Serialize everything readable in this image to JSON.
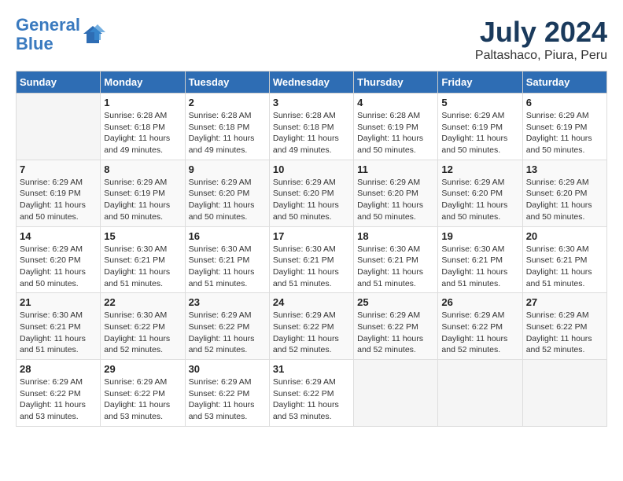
{
  "header": {
    "logo_line1": "General",
    "logo_line2": "Blue",
    "title": "July 2024",
    "subtitle": "Paltashaco, Piura, Peru"
  },
  "calendar": {
    "days_of_week": [
      "Sunday",
      "Monday",
      "Tuesday",
      "Wednesday",
      "Thursday",
      "Friday",
      "Saturday"
    ],
    "weeks": [
      [
        {
          "day": "",
          "info": ""
        },
        {
          "day": "1",
          "info": "Sunrise: 6:28 AM\nSunset: 6:18 PM\nDaylight: 11 hours and 49 minutes."
        },
        {
          "day": "2",
          "info": "Sunrise: 6:28 AM\nSunset: 6:18 PM\nDaylight: 11 hours and 49 minutes."
        },
        {
          "day": "3",
          "info": "Sunrise: 6:28 AM\nSunset: 6:18 PM\nDaylight: 11 hours and 49 minutes."
        },
        {
          "day": "4",
          "info": "Sunrise: 6:28 AM\nSunset: 6:19 PM\nDaylight: 11 hours and 50 minutes."
        },
        {
          "day": "5",
          "info": "Sunrise: 6:29 AM\nSunset: 6:19 PM\nDaylight: 11 hours and 50 minutes."
        },
        {
          "day": "6",
          "info": "Sunrise: 6:29 AM\nSunset: 6:19 PM\nDaylight: 11 hours and 50 minutes."
        }
      ],
      [
        {
          "day": "7",
          "info": "Sunrise: 6:29 AM\nSunset: 6:19 PM\nDaylight: 11 hours and 50 minutes."
        },
        {
          "day": "8",
          "info": "Sunrise: 6:29 AM\nSunset: 6:19 PM\nDaylight: 11 hours and 50 minutes."
        },
        {
          "day": "9",
          "info": "Sunrise: 6:29 AM\nSunset: 6:20 PM\nDaylight: 11 hours and 50 minutes."
        },
        {
          "day": "10",
          "info": "Sunrise: 6:29 AM\nSunset: 6:20 PM\nDaylight: 11 hours and 50 minutes."
        },
        {
          "day": "11",
          "info": "Sunrise: 6:29 AM\nSunset: 6:20 PM\nDaylight: 11 hours and 50 minutes."
        },
        {
          "day": "12",
          "info": "Sunrise: 6:29 AM\nSunset: 6:20 PM\nDaylight: 11 hours and 50 minutes."
        },
        {
          "day": "13",
          "info": "Sunrise: 6:29 AM\nSunset: 6:20 PM\nDaylight: 11 hours and 50 minutes."
        }
      ],
      [
        {
          "day": "14",
          "info": "Sunrise: 6:29 AM\nSunset: 6:20 PM\nDaylight: 11 hours and 50 minutes."
        },
        {
          "day": "15",
          "info": "Sunrise: 6:30 AM\nSunset: 6:21 PM\nDaylight: 11 hours and 51 minutes."
        },
        {
          "day": "16",
          "info": "Sunrise: 6:30 AM\nSunset: 6:21 PM\nDaylight: 11 hours and 51 minutes."
        },
        {
          "day": "17",
          "info": "Sunrise: 6:30 AM\nSunset: 6:21 PM\nDaylight: 11 hours and 51 minutes."
        },
        {
          "day": "18",
          "info": "Sunrise: 6:30 AM\nSunset: 6:21 PM\nDaylight: 11 hours and 51 minutes."
        },
        {
          "day": "19",
          "info": "Sunrise: 6:30 AM\nSunset: 6:21 PM\nDaylight: 11 hours and 51 minutes."
        },
        {
          "day": "20",
          "info": "Sunrise: 6:30 AM\nSunset: 6:21 PM\nDaylight: 11 hours and 51 minutes."
        }
      ],
      [
        {
          "day": "21",
          "info": "Sunrise: 6:30 AM\nSunset: 6:21 PM\nDaylight: 11 hours and 51 minutes."
        },
        {
          "day": "22",
          "info": "Sunrise: 6:30 AM\nSunset: 6:22 PM\nDaylight: 11 hours and 52 minutes."
        },
        {
          "day": "23",
          "info": "Sunrise: 6:29 AM\nSunset: 6:22 PM\nDaylight: 11 hours and 52 minutes."
        },
        {
          "day": "24",
          "info": "Sunrise: 6:29 AM\nSunset: 6:22 PM\nDaylight: 11 hours and 52 minutes."
        },
        {
          "day": "25",
          "info": "Sunrise: 6:29 AM\nSunset: 6:22 PM\nDaylight: 11 hours and 52 minutes."
        },
        {
          "day": "26",
          "info": "Sunrise: 6:29 AM\nSunset: 6:22 PM\nDaylight: 11 hours and 52 minutes."
        },
        {
          "day": "27",
          "info": "Sunrise: 6:29 AM\nSunset: 6:22 PM\nDaylight: 11 hours and 52 minutes."
        }
      ],
      [
        {
          "day": "28",
          "info": "Sunrise: 6:29 AM\nSunset: 6:22 PM\nDaylight: 11 hours and 53 minutes."
        },
        {
          "day": "29",
          "info": "Sunrise: 6:29 AM\nSunset: 6:22 PM\nDaylight: 11 hours and 53 minutes."
        },
        {
          "day": "30",
          "info": "Sunrise: 6:29 AM\nSunset: 6:22 PM\nDaylight: 11 hours and 53 minutes."
        },
        {
          "day": "31",
          "info": "Sunrise: 6:29 AM\nSunset: 6:22 PM\nDaylight: 11 hours and 53 minutes."
        },
        {
          "day": "",
          "info": ""
        },
        {
          "day": "",
          "info": ""
        },
        {
          "day": "",
          "info": ""
        }
      ]
    ]
  }
}
